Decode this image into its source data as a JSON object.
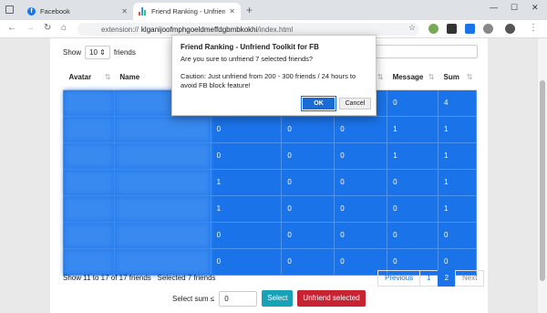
{
  "browser": {
    "tabs": [
      {
        "title": "Facebook",
        "active": false
      },
      {
        "title": "Friend Ranking - Unfriend Toolkit",
        "active": true
      }
    ],
    "url_prefix": "extension://",
    "url_host": "klganijoofmphgoeldmeffdgbmbkokhi",
    "url_path": "/index.html"
  },
  "toolbar": {
    "show_label": "Show",
    "page_size": "10",
    "friends_label": "friends"
  },
  "table": {
    "columns": [
      "Avatar",
      "Name",
      "",
      "",
      "",
      "Message",
      "Sum"
    ],
    "rows": [
      [
        "",
        "",
        "",
        "",
        "",
        "0",
        "4"
      ],
      [
        "",
        "",
        "0",
        "0",
        "0",
        "1",
        "1"
      ],
      [
        "",
        "",
        "0",
        "0",
        "0",
        "1",
        "1"
      ],
      [
        "",
        "",
        "1",
        "0",
        "0",
        "0",
        "1"
      ],
      [
        "",
        "",
        "1",
        "0",
        "0",
        "0",
        "1"
      ],
      [
        "",
        "",
        "0",
        "0",
        "0",
        "0",
        "0"
      ],
      [
        "",
        "",
        "0",
        "0",
        "0",
        "0",
        "0"
      ]
    ]
  },
  "footer": {
    "info": "Show 11 to 17 of 17 friends",
    "selected": "Selected 7 friends"
  },
  "pager": {
    "prev": "Previous",
    "p1": "1",
    "p2": "2",
    "next": "Next"
  },
  "bottom": {
    "select_label": "Select sum ≤",
    "sum_value": "0",
    "select_btn": "Select",
    "unfriend_btn": "Unfriend selected"
  },
  "dialog": {
    "title": "Friend Ranking - Unfriend Toolkit for FB",
    "question": "Are you sure to unfriend 7 selected friends?",
    "warning": "Caution: Just unfriend from 200 - 300 friends / 24 hours to avoid FB block feature!",
    "ok": "OK",
    "cancel": "Cancel"
  }
}
